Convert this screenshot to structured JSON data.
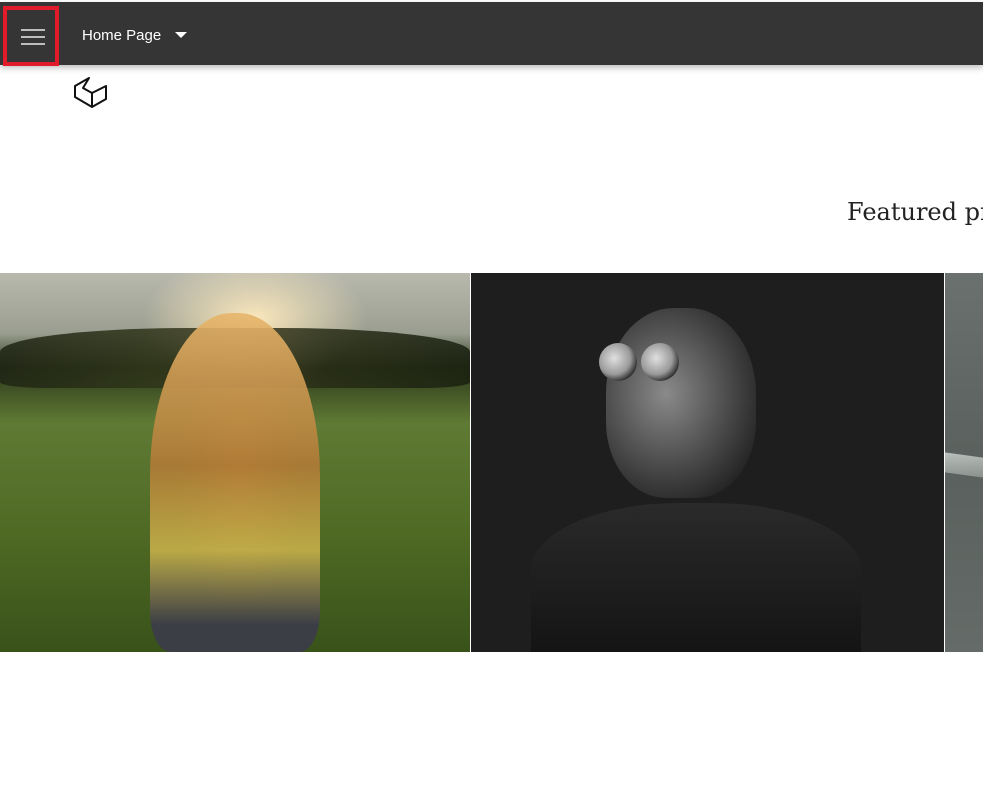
{
  "toolbar": {
    "menu_icon": "hamburger-menu-icon",
    "page_select_label": "Home Page",
    "page_select_icon": "caret-down-icon",
    "background_color": "#353535",
    "highlight_color": "#e21b2a"
  },
  "logo": {
    "icon": "cube-logo-icon"
  },
  "section": {
    "heading": "Featured pro"
  },
  "gallery": {
    "items": [
      {
        "alt": "woman-walking-in-sunlit-field"
      },
      {
        "alt": "man-wearing-goggles"
      },
      {
        "alt": "partial-gray-photo"
      }
    ]
  }
}
